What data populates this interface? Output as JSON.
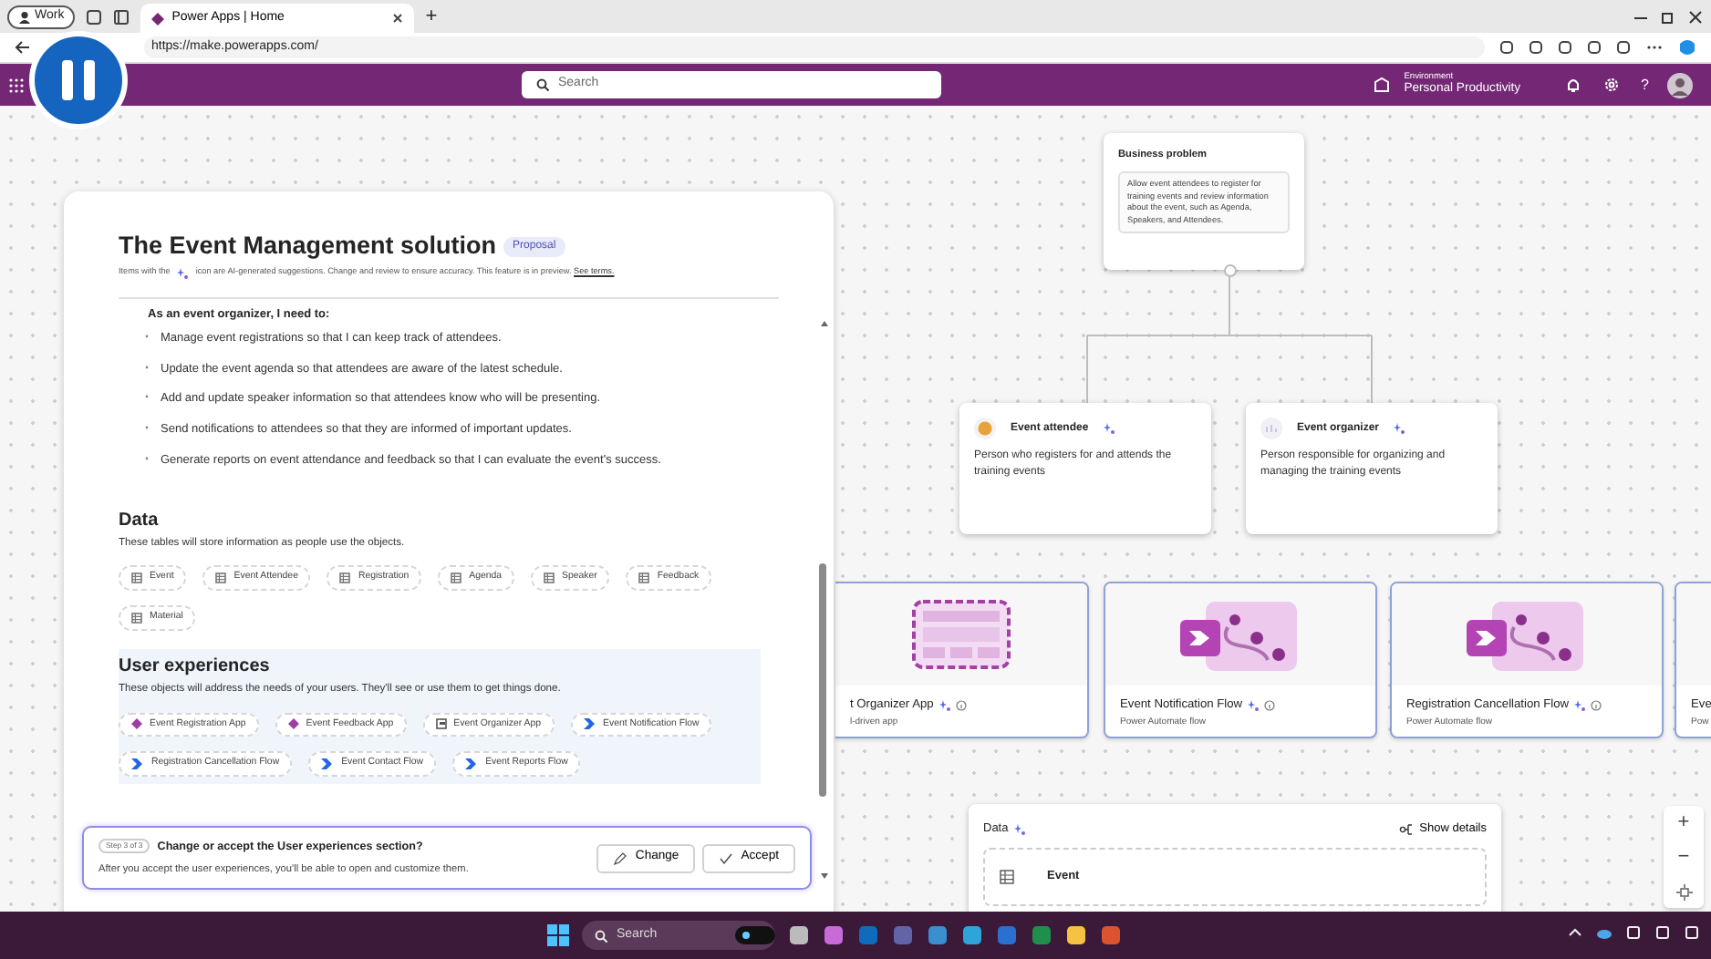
{
  "browser": {
    "profile": "Work",
    "tabs": [
      {
        "title": "Power Apps | Home",
        "selected": true
      }
    ],
    "new_tab": "+",
    "url": "https://make.powerapps.com/"
  },
  "app_bar": {
    "search_placeholder": "Search",
    "environment_label": "Environment",
    "environment": "Personal Productivity",
    "help": "?"
  },
  "panel": {
    "title": "The Event Management solution",
    "badge": "Proposal",
    "note_before": "Items with the",
    "note_after": "icon are AI-generated suggestions. Change and review to ensure accuracy. This feature is in preview.",
    "note_link": "See terms.",
    "requirements_heading": "As an event organizer, I need to:",
    "requirements": [
      "Manage event registrations so that I can keep track of attendees.",
      "Update the event agenda so that attendees are aware of the latest schedule.",
      "Add and update speaker information so that attendees know who will be presenting.",
      "Send notifications to attendees so that they are informed of important updates.",
      "Generate reports on event attendance and feedback so that I can evaluate the event's success."
    ],
    "data_heading": "Data",
    "data_desc": "These tables will store information as people use the objects.",
    "tables": [
      "Event",
      "Event Attendee",
      "Registration",
      "Agenda",
      "Speaker",
      "Feedback",
      "Material"
    ],
    "ux_heading": "User experiences",
    "ux_desc": "These objects will address the needs of your users. They'll see or use them to get things done.",
    "experiences": [
      {
        "label": "Event Registration App",
        "kind": "canvas_app"
      },
      {
        "label": "Event Feedback App",
        "kind": "canvas_app"
      },
      {
        "label": "Event Organizer App",
        "kind": "model_app"
      },
      {
        "label": "Event Notification Flow",
        "kind": "flow"
      },
      {
        "label": "Registration Cancellation Flow",
        "kind": "flow"
      },
      {
        "label": "Event Contact Flow",
        "kind": "flow"
      },
      {
        "label": "Event Reports Flow",
        "kind": "flow"
      }
    ],
    "prompt": {
      "step": "Step 3 of 3",
      "question": "Change or accept the User experiences section?",
      "detail": "After you accept the user experiences, you'll be able to open and customize them.",
      "buttons": [
        "Change",
        "Accept"
      ]
    }
  },
  "canvas": {
    "business_problem": {
      "title": "Business problem",
      "text": "Allow event attendees to register for training events and review information about the event, such as Agenda, Speakers, and Attendees."
    },
    "personas": [
      {
        "title": "Event attendee",
        "text": "Person who registers for and attends the training events",
        "kind": "attendee"
      },
      {
        "title": "Event organizer",
        "text": "Person responsible for organizing and managing the training events",
        "kind": "organizer"
      }
    ],
    "experiences": [
      {
        "name": "t Organizer App",
        "type": "l-driven app",
        "kind": "model_app"
      },
      {
        "name": "Event Notification Flow",
        "type": "Power Automate flow",
        "kind": "flow"
      },
      {
        "name": "Registration Cancellation Flow",
        "type": "Power Automate flow",
        "kind": "flow"
      },
      {
        "name": "Eve",
        "type": "Pow",
        "kind": "flow"
      }
    ],
    "data": {
      "title": "Data",
      "show_details": "Show details",
      "tables": [
        "Event"
      ]
    },
    "zoom": [
      "+",
      "−"
    ]
  },
  "taskbar": {
    "search": "Search"
  }
}
